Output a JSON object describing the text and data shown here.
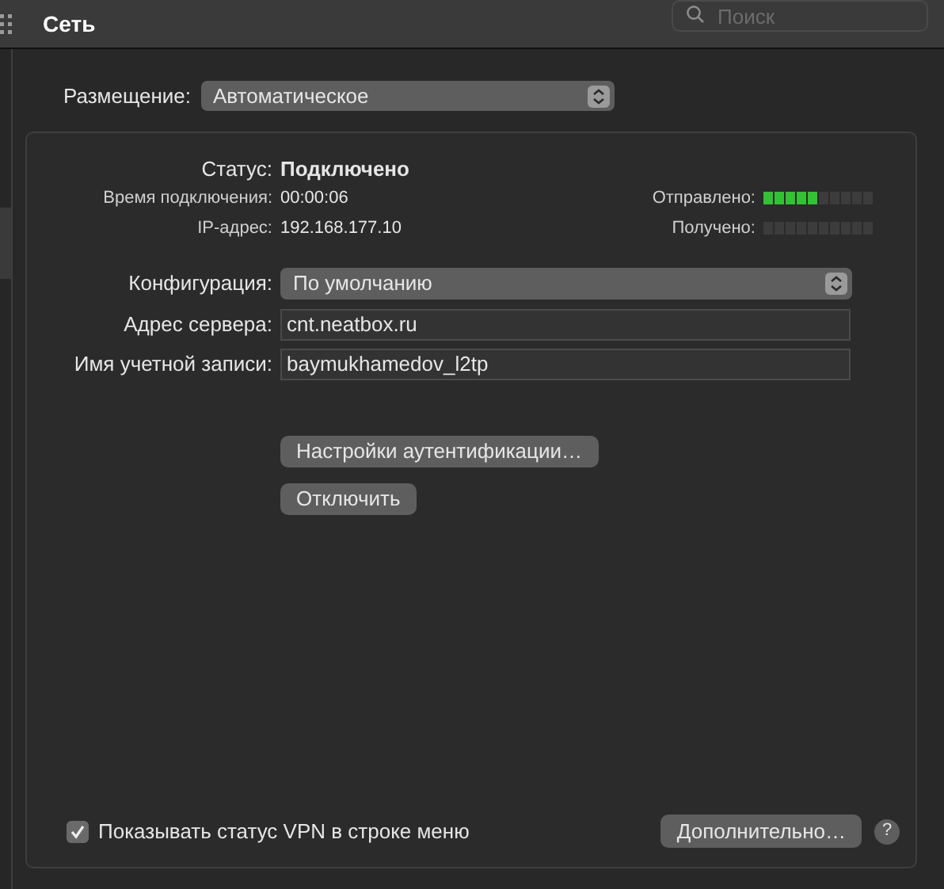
{
  "window": {
    "title": "Сеть"
  },
  "search": {
    "placeholder": "Поиск"
  },
  "location": {
    "label": "Размещение:",
    "value": "Автоматическое"
  },
  "status": {
    "label": "Статус:",
    "value": "Подключено"
  },
  "info": [
    {
      "label": "Время подключения:",
      "value": "00:00:06"
    },
    {
      "label": "IP-адрес:",
      "value": "192.168.177.10"
    }
  ],
  "meters": [
    {
      "label": "Отправлено:",
      "level": 0.5
    },
    {
      "label": "Получено:"
    }
  ],
  "configuration": {
    "label": "Конфигурация:",
    "value": "По умолчанию"
  },
  "fields": [
    {
      "label": "Адрес сервера:",
      "value": "cnt.neatbox.ru"
    },
    {
      "label": "Имя учетной записи:",
      "value": "baymukhamedov_l2tp"
    }
  ],
  "buttons": [
    "Настройки аутентификации…",
    "Отключить"
  ],
  "show_vpn_status": {
    "label": "Показывать статус VPN в строке меню",
    "checked": true
  },
  "advanced_button": "Дополнительно…",
  "help_button": "?"
}
